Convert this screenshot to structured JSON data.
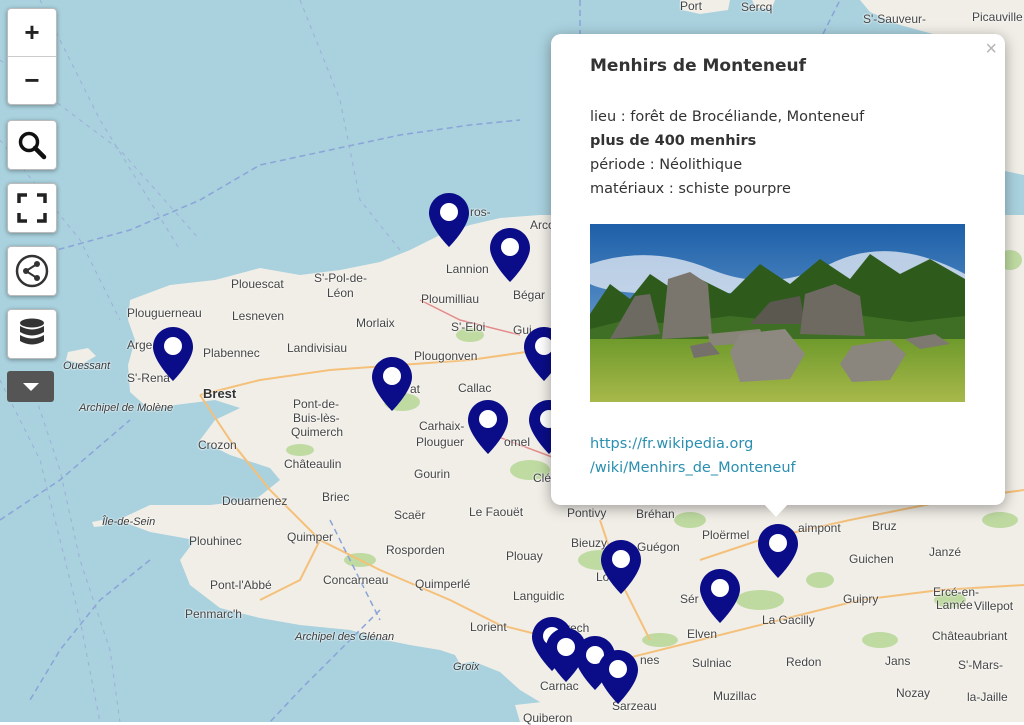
{
  "map": {
    "colors": {
      "sea": "#a9d1de",
      "land": "#f1eee7",
      "forest": "#b9d89a",
      "marker": "#0a0d87"
    },
    "places": [
      {
        "id": "port",
        "label": "Port"
      },
      {
        "id": "sercq",
        "label": "Sercq"
      },
      {
        "id": "st-sauveur",
        "label": "S'-Sauveur-"
      },
      {
        "id": "picauville",
        "label": "Picauville"
      },
      {
        "id": "perros",
        "label": "ros-"
      },
      {
        "id": "lannion",
        "label": "Lannion"
      },
      {
        "id": "begard",
        "label": "Bégar"
      },
      {
        "id": "plouescat",
        "label": "Plouescat"
      },
      {
        "id": "st-pol",
        "label": "S'-Pol-de-"
      },
      {
        "id": "leon",
        "label": "Léon"
      },
      {
        "id": "plouguerneau",
        "label": "Plouguerneau"
      },
      {
        "id": "lesneven",
        "label": "Lesneven"
      },
      {
        "id": "plouigneau",
        "label": "Ploumilliau"
      },
      {
        "id": "morlaix",
        "label": "Morlaix"
      },
      {
        "id": "st-eloi",
        "label": "S'-Eloi"
      },
      {
        "id": "guin",
        "label": "Gui"
      },
      {
        "id": "arge",
        "label": "Arge"
      },
      {
        "id": "plabennec",
        "label": "Plabennec"
      },
      {
        "id": "landivisiau",
        "label": "Landivisiau"
      },
      {
        "id": "plougonven",
        "label": "Plougonven"
      },
      {
        "id": "ouessant",
        "label": "Ouessant"
      },
      {
        "id": "st-renan",
        "label": "S'-Rena"
      },
      {
        "id": "callac",
        "label": "Callac"
      },
      {
        "id": "brest",
        "label": "Brest"
      },
      {
        "id": "huelgoat",
        "label": "at"
      },
      {
        "id": "archipel-molene",
        "label": "Archipel de Molène"
      },
      {
        "id": "pont-de-buis",
        "label": "Pont-de-"
      },
      {
        "id": "buis",
        "label": "Buis-lès-"
      },
      {
        "id": "quimerch",
        "label": "Quimerch"
      },
      {
        "id": "carhaix",
        "label": "Carhaix-"
      },
      {
        "id": "plouguer",
        "label": "Plouguer"
      },
      {
        "id": "rostrenen",
        "label": "omel"
      },
      {
        "id": "crozon",
        "label": "Crozon"
      },
      {
        "id": "chateaulin",
        "label": "Châteaulin"
      },
      {
        "id": "gourin",
        "label": "Gourin"
      },
      {
        "id": "cle",
        "label": "Clé"
      },
      {
        "id": "douarnenez",
        "label": "Douarnenez"
      },
      {
        "id": "briec",
        "label": "Briec"
      },
      {
        "id": "le-faouet",
        "label": "Le Faouët"
      },
      {
        "id": "pontivy",
        "label": "Pontivy"
      },
      {
        "id": "brehan",
        "label": "Bréhan"
      },
      {
        "id": "ile-de-sein",
        "label": "Île-de-Sein"
      },
      {
        "id": "scaer",
        "label": "Scaër"
      },
      {
        "id": "plouhinec",
        "label": "Plouhinec"
      },
      {
        "id": "quimper",
        "label": "Quimper"
      },
      {
        "id": "bieuzy",
        "label": "Bieuzy"
      },
      {
        "id": "gueguon",
        "label": "Guégon"
      },
      {
        "id": "rosporden",
        "label": "Rosporden"
      },
      {
        "id": "ploermel",
        "label": "Ploërmel"
      },
      {
        "id": "paimpont",
        "label": "aimpont"
      },
      {
        "id": "bruz",
        "label": "Bruz"
      },
      {
        "id": "janze",
        "label": "Janzé"
      },
      {
        "id": "plouay",
        "label": "Plouay"
      },
      {
        "id": "locmine",
        "label": "Lo"
      },
      {
        "id": "guichen",
        "label": "Guichen"
      },
      {
        "id": "pont-labbe",
        "label": "Pont-l'Abbé"
      },
      {
        "id": "concarneau",
        "label": "Concarneau"
      },
      {
        "id": "quimperle",
        "label": "Quimperlé"
      },
      {
        "id": "languidic",
        "label": "Languidic"
      },
      {
        "id": "serent",
        "label": "Sér"
      },
      {
        "id": "guipry",
        "label": "Guipry"
      },
      {
        "id": "erce",
        "label": "Ercé-en-"
      },
      {
        "id": "lamee",
        "label": "Lamée"
      },
      {
        "id": "villepot",
        "label": "Villepot"
      },
      {
        "id": "penmarch",
        "label": "Penmarc'h"
      },
      {
        "id": "la-gacilly",
        "label": "La Gacilly"
      },
      {
        "id": "lorient",
        "label": "Lorient"
      },
      {
        "id": "hennebont",
        "label": "rech"
      },
      {
        "id": "elven",
        "label": "Elven"
      },
      {
        "id": "chateaubriant",
        "label": "Châteaubriant"
      },
      {
        "id": "archipel-glenan",
        "label": "Archipel des Glénan"
      },
      {
        "id": "vannes",
        "label": "nes"
      },
      {
        "id": "sulniac",
        "label": "Sulniac"
      },
      {
        "id": "redon",
        "label": "Redon"
      },
      {
        "id": "jans",
        "label": "Jans"
      },
      {
        "id": "st-mars",
        "label": "S'-Mars-"
      },
      {
        "id": "groix",
        "label": "Groix"
      },
      {
        "id": "carnac",
        "label": "Carnac"
      },
      {
        "id": "muzillac",
        "label": "Muzillac"
      },
      {
        "id": "nozay",
        "label": "Nozay"
      },
      {
        "id": "la-jaille",
        "label": "la-Jaille"
      },
      {
        "id": "sarzeau",
        "label": "Sarzeau"
      },
      {
        "id": "quiberon",
        "label": "Quiberon"
      },
      {
        "id": "arco",
        "label": "Arco"
      }
    ]
  },
  "controls": {
    "zoom_in": "+",
    "zoom_out": "−"
  },
  "popup": {
    "title": "Menhirs de Monteneuf",
    "lieu": "lieu : forêt de Brocéliande, Monteneuf",
    "menhirs": "plus de 400 menhirs",
    "periode": "période : Néolithique",
    "materiaux": "matériaux : schiste pourpre",
    "link_line1": "https://fr.wikipedia.org",
    "link_line2": "/wiki/Menhirs_de_Monteneuf",
    "close": "×"
  }
}
